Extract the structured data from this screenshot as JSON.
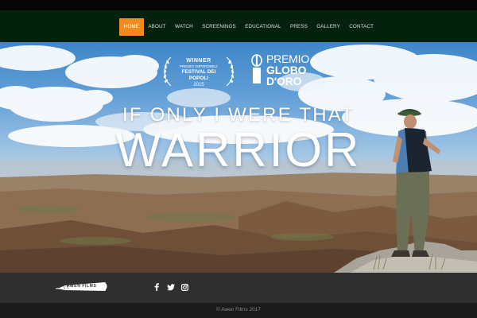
{
  "nav": {
    "items": [
      {
        "label": "HOME",
        "active": true
      },
      {
        "label": "ABOUT",
        "active": false
      },
      {
        "label": "WATCH",
        "active": false
      },
      {
        "label": "SCREENINGS",
        "active": false
      },
      {
        "label": "EDUCATIONAL",
        "active": false
      },
      {
        "label": "PRESS",
        "active": false
      },
      {
        "label": "GALLERY",
        "active": false
      },
      {
        "label": "CONTACT",
        "active": false
      }
    ],
    "active_color": "#f28b1e",
    "background": "#04210e"
  },
  "hero": {
    "award": {
      "line1": "WINNER",
      "line2": "PREMIO 'IMPERDIBILI'",
      "line3": "FESTIVAL DEI POPOLI",
      "line4": "2015"
    },
    "globo": {
      "line1": "PREMIO",
      "line2": "GLOBO",
      "line3": "D'ORO"
    },
    "title_line1": "IF ONLY I WERE THAT",
    "title_line2": "WARRIOR"
  },
  "footer": {
    "logo_text": "AWEN FILMS",
    "social": [
      {
        "icon": "facebook-icon",
        "glyph": "f"
      },
      {
        "icon": "twitter-icon",
        "glyph": "t"
      },
      {
        "icon": "instagram-icon",
        "glyph": "i"
      }
    ],
    "copyright": "© Awen Films 2017"
  }
}
